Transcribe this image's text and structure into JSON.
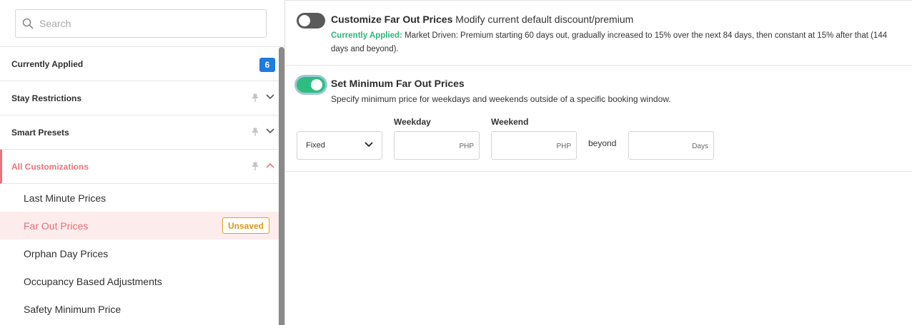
{
  "sidebar": {
    "search_placeholder": "Search",
    "sections": [
      {
        "label": "Currently Applied",
        "badge": "6"
      },
      {
        "label": "Stay Restrictions"
      },
      {
        "label": "Smart Presets"
      },
      {
        "label": "All Customizations"
      }
    ],
    "sub_items": [
      {
        "label": "Last Minute Prices"
      },
      {
        "label": "Far Out Prices",
        "badge": "Unsaved"
      },
      {
        "label": "Orphan Day Prices"
      },
      {
        "label": "Occupancy Based Adjustments"
      },
      {
        "label": "Safety Minimum Price"
      }
    ]
  },
  "main": {
    "customize": {
      "title": "Customize Far Out Prices",
      "description": "Modify current default discount/premium",
      "applied_label": "Currently Applied:",
      "applied_text": "Market Driven: Premium starting 60 days out, gradually increased to 15% over the next 84 days, then constant at 15% after that (144 days and beyond).",
      "toggle_on": false
    },
    "minimum": {
      "title": "Set Minimum Far Out Prices",
      "description": "Specify minimum price for weekdays and weekends outside of a specific booking window.",
      "toggle_on": true,
      "select_value": "Fixed",
      "weekday_label": "Weekday",
      "weekend_label": "Weekend",
      "weekday_unit": "PHP",
      "weekend_unit": "PHP",
      "beyond_label": "beyond",
      "days_unit": "Days"
    }
  },
  "colors": {
    "accent_red": "#e8747a",
    "badge_blue": "#1e7be0",
    "toggle_green": "#2dbd80",
    "unsaved_amber": "#e0a31d"
  }
}
